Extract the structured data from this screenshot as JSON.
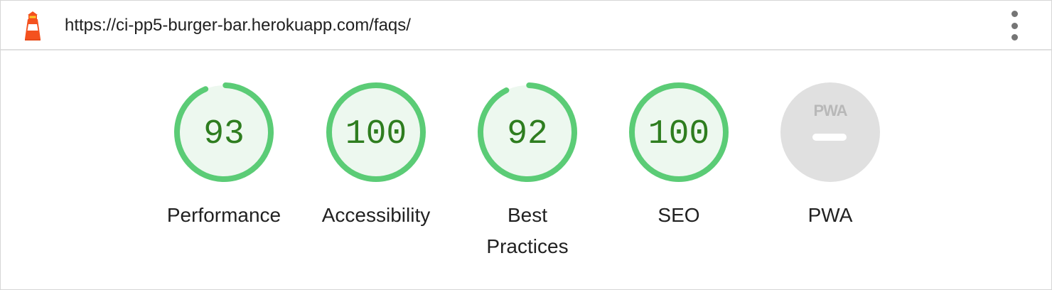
{
  "header": {
    "url": "https://ci-pp5-burger-bar.herokuapp.com/faqs/",
    "logo_icon": "lighthouse-icon",
    "menu_icon": "more-vertical-icon"
  },
  "colors": {
    "pass": "#0cce6b",
    "pass_ring": "#5bcc76",
    "pass_fill": "#edf8ef",
    "score_text": "#2e7d1f",
    "na_fill": "#e0e0e0"
  },
  "gauges": [
    {
      "label": "Performance",
      "score": 93
    },
    {
      "label": "Accessibility",
      "score": 100
    },
    {
      "label": "Best Practices",
      "score": 92
    },
    {
      "label": "SEO",
      "score": 100
    },
    {
      "label": "PWA",
      "score": null,
      "badge_text": "PWA"
    }
  ]
}
